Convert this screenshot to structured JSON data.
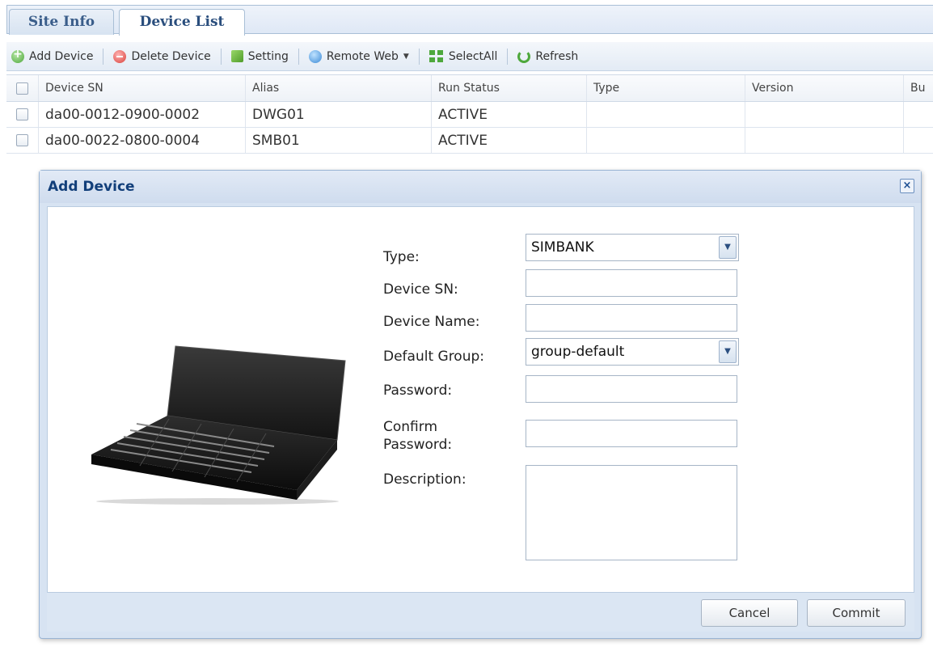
{
  "tabs": [
    {
      "label": "Site Info",
      "active": false
    },
    {
      "label": "Device List",
      "active": true
    }
  ],
  "toolbar": {
    "add_device": "Add Device",
    "delete_device": "Delete Device",
    "setting": "Setting",
    "remote_web": "Remote Web",
    "select_all": "SelectAll",
    "refresh": "Refresh"
  },
  "grid": {
    "columns": [
      "Device SN",
      "Alias",
      "Run Status",
      "Type",
      "Version",
      "Bu"
    ],
    "rows": [
      {
        "sn": "da00-0012-0900-0002",
        "alias": "DWG01",
        "status": "ACTIVE",
        "type": "",
        "version": ""
      },
      {
        "sn": "da00-0022-0800-0004",
        "alias": "SMB01",
        "status": "ACTIVE",
        "type": "",
        "version": ""
      }
    ]
  },
  "dialog": {
    "title": "Add Device",
    "close": "×",
    "labels": {
      "type": "Type:",
      "device_sn": "Device SN:",
      "device_name": "Device Name:",
      "default_group": "Default Group:",
      "password": "Password:",
      "confirm_password_1": "Confirm",
      "confirm_password_2": "Password:",
      "description": "Description:"
    },
    "values": {
      "type": "SIMBANK",
      "device_sn": "",
      "device_name": "",
      "default_group": "group-default",
      "password": "",
      "confirm_password": "",
      "description": ""
    },
    "buttons": {
      "cancel": "Cancel",
      "commit": "Commit"
    }
  },
  "colors": {
    "accent": "#123f7a",
    "tab_text": "#2a4e7d",
    "dialog_bg": "#d7e3f2"
  }
}
